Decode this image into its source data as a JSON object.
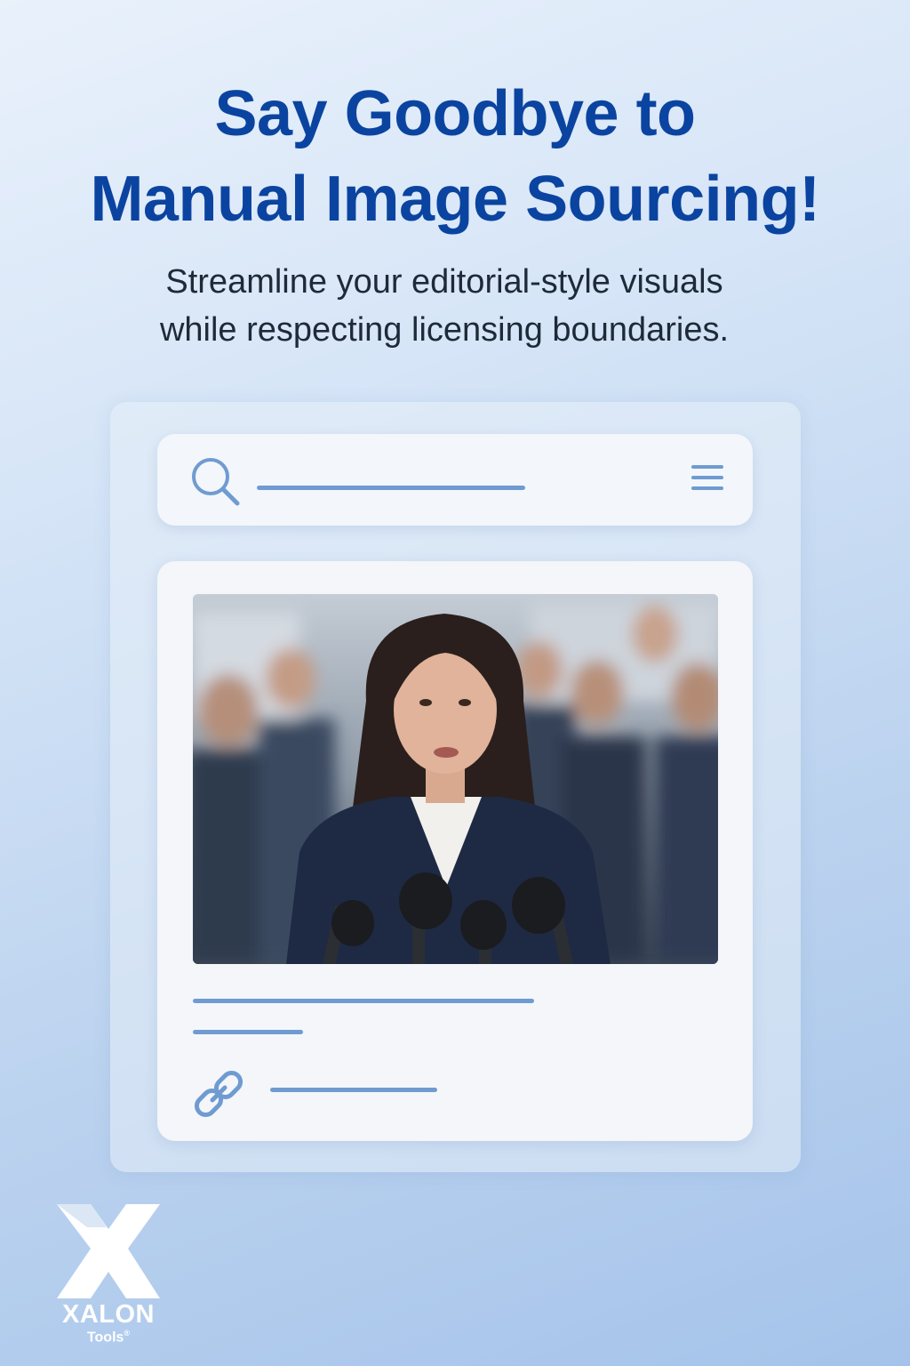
{
  "headline": {
    "line1": "Say Goodbye to",
    "line2": "Manual Image Sourcing!"
  },
  "subhead": {
    "line1": "Streamline your editorial-style visuals",
    "line2": "while respecting licensing boundaries."
  },
  "mockup": {
    "search_icon": "search-icon",
    "menu_icon": "hamburger-menu-icon",
    "link_icon": "link-icon",
    "photo_subject": "woman speaking at press conference microphones"
  },
  "brand": {
    "name": "XALON",
    "sub": "Tools",
    "mark": "®"
  },
  "colors": {
    "headline": "#0b44a0",
    "accent": "#6f9bd1",
    "text": "#1e2a38"
  }
}
